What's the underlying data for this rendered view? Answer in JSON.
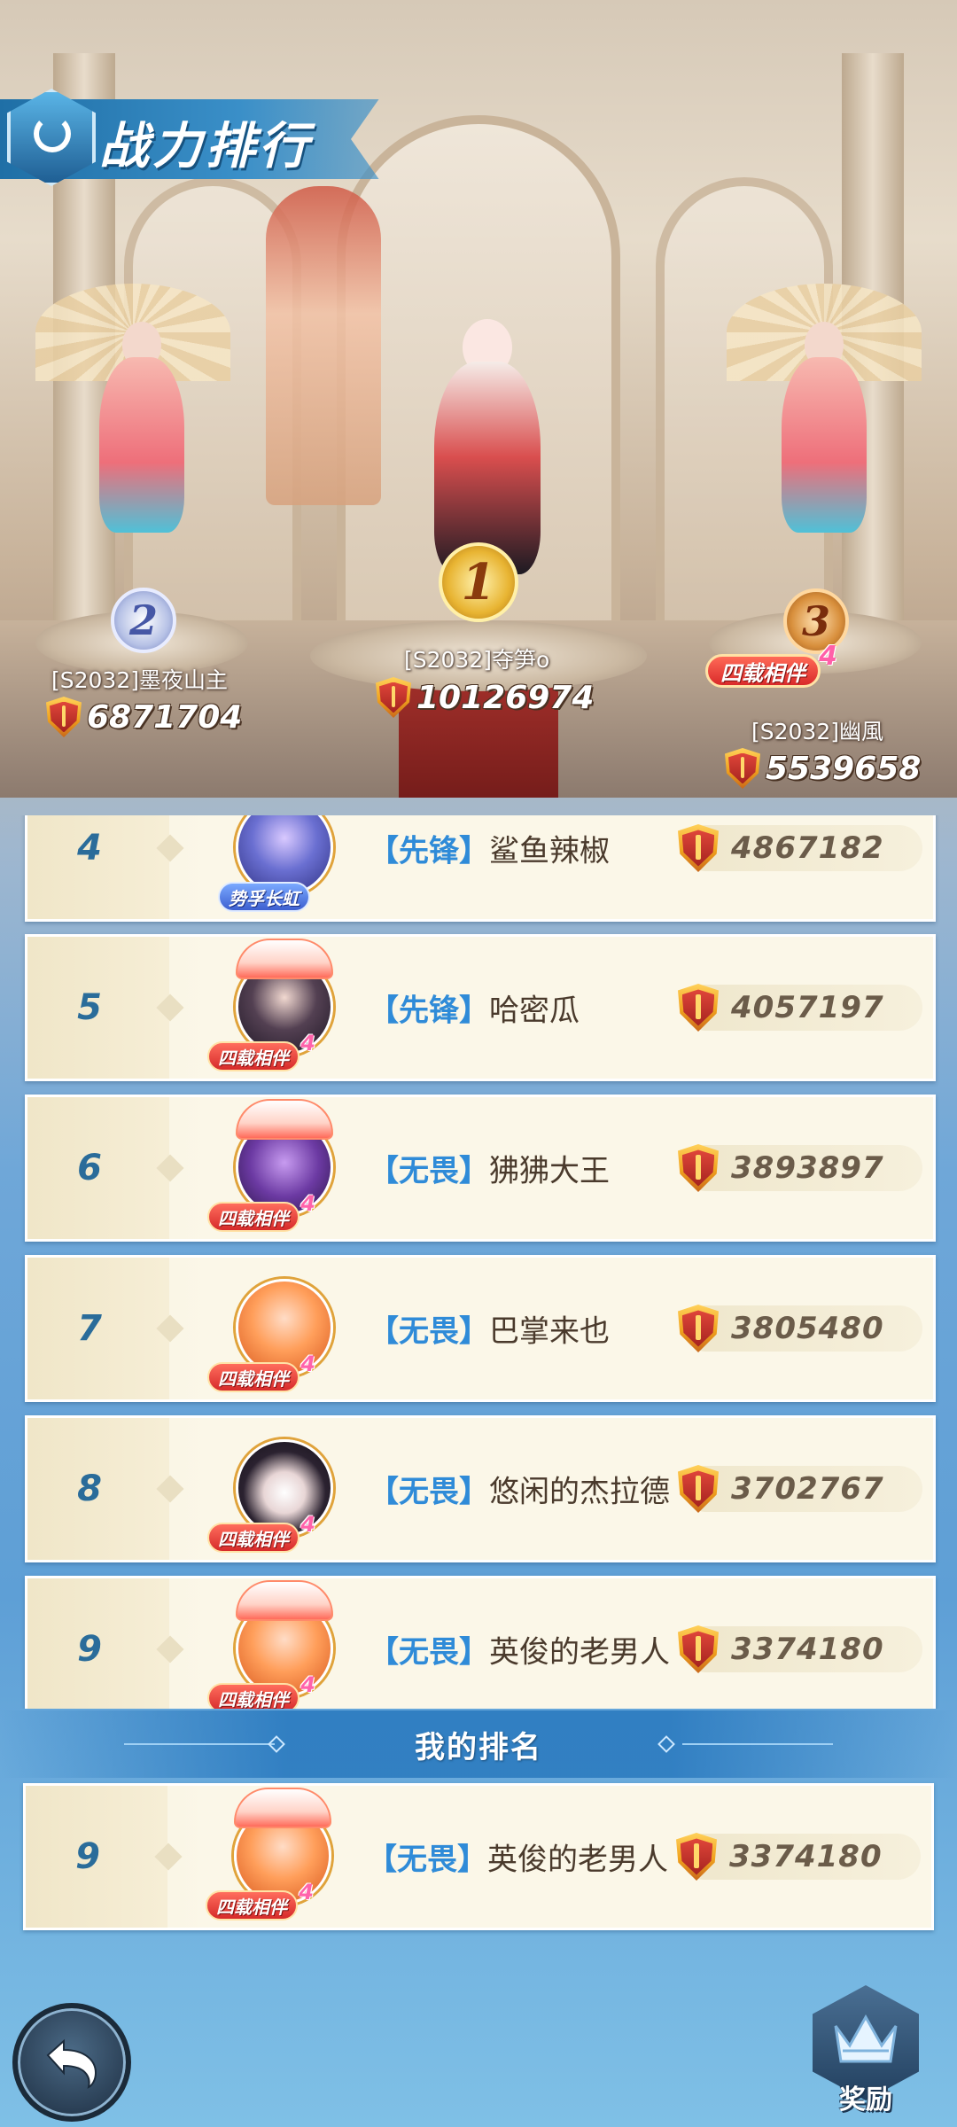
{
  "header": {
    "title": "战力排行"
  },
  "top3": [
    {
      "rank": "1",
      "name": "[S2032]夺笋o",
      "power": "10126974"
    },
    {
      "rank": "2",
      "name": "[S2032]墨夜山主",
      "power": "6871704"
    },
    {
      "rank": "3",
      "name": "[S2032]幽風",
      "power": "5539658",
      "badge": "四载相伴",
      "badge_num": "4"
    }
  ],
  "list": [
    {
      "rank": "4",
      "guild": "【先锋】",
      "name": "鲨鱼辣椒",
      "power": "4867182",
      "tag": "势孚长虹"
    },
    {
      "rank": "5",
      "guild": "【先锋】",
      "name": "哈密瓜",
      "power": "4057197",
      "tag": "四载相伴",
      "tag_num": "4"
    },
    {
      "rank": "6",
      "guild": "【无畏】",
      "name": "狒狒大王",
      "power": "3893897",
      "tag": "四载相伴",
      "tag_num": "4"
    },
    {
      "rank": "7",
      "guild": "【无畏】",
      "name": "巴掌来也",
      "power": "3805480",
      "tag": "四载相伴",
      "tag_num": "4"
    },
    {
      "rank": "8",
      "guild": "【无畏】",
      "name": "悠闲的杰拉德",
      "power": "3702767",
      "tag": "四载相伴",
      "tag_num": "4"
    },
    {
      "rank": "9",
      "guild": "【无畏】",
      "name": "英俊的老男人",
      "power": "3374180",
      "tag": "四载相伴",
      "tag_num": "4"
    }
  ],
  "my_rank": {
    "title": "我的排名",
    "rank": "9",
    "guild": "【无畏】",
    "name": "英俊的老男人",
    "power": "3374180",
    "tag": "四载相伴",
    "tag_num": "4"
  },
  "buttons": {
    "reward_label": "奖励"
  },
  "colors": {
    "guild_blue": "#2f8bd8",
    "rank_blue": "#2a6c9a",
    "panel_cream": "#fbf7e8",
    "title_banner": "#3a8fc8"
  },
  "icons": {
    "power": "shield-sword-icon",
    "back": "back-arrow-icon",
    "reward": "crown-reward-icon",
    "title": "rank-emblem-icon"
  }
}
